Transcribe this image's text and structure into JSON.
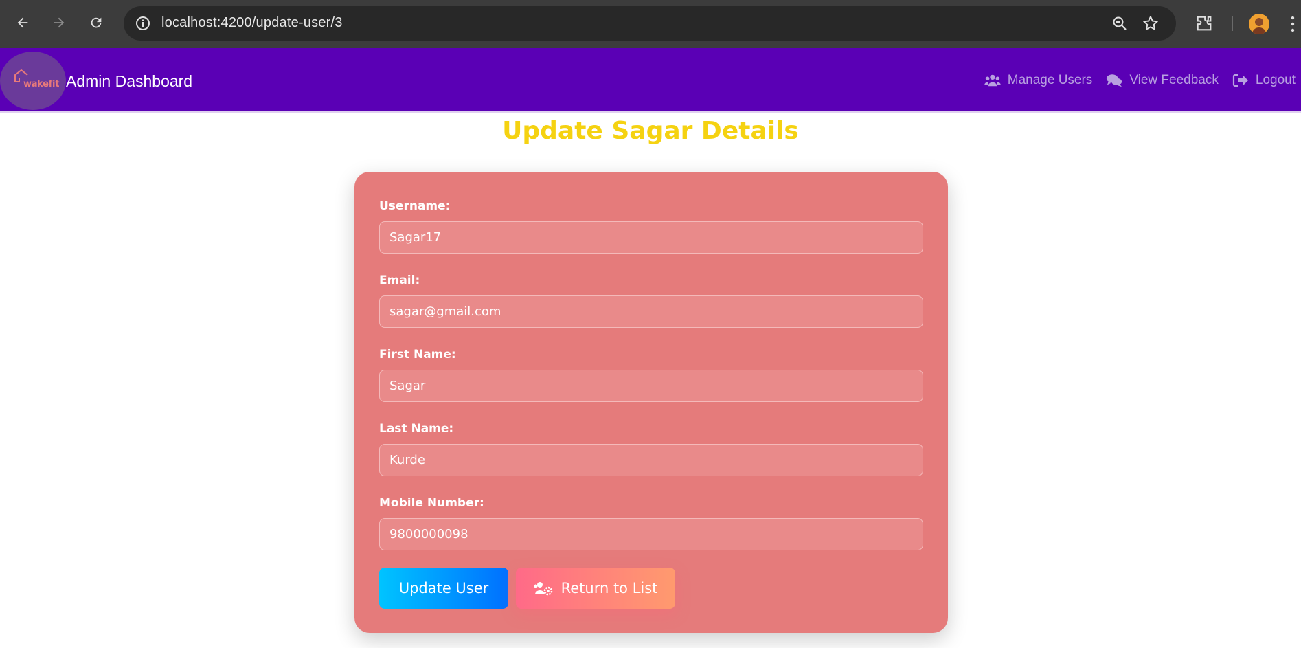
{
  "browser": {
    "url_host": "localhost",
    "url_path": ":4200/update-user/3",
    "icons": [
      "back-arrow-icon",
      "forward-arrow-icon",
      "reload-icon",
      "info-icon",
      "zoom-icon",
      "bookmark-star-icon",
      "extensions-icon",
      "profile-avatar",
      "menu-kebab-icon"
    ]
  },
  "navbar": {
    "logo_text": "wakefit",
    "title": "Admin Dashboard",
    "links": [
      {
        "label": "Manage Users",
        "icon": "users-icon"
      },
      {
        "label": "View Feedback",
        "icon": "comments-icon"
      },
      {
        "label": "Logout",
        "icon": "logout-icon"
      }
    ],
    "bg_color": "#5a00b5"
  },
  "page": {
    "title": "Update Sagar Details",
    "title_color": "#f5d211"
  },
  "form": {
    "fields": [
      {
        "label": "Username:",
        "value": "Sagar17"
      },
      {
        "label": "Email:",
        "value": "sagar@gmail.com"
      },
      {
        "label": "First Name:",
        "value": "Sagar"
      },
      {
        "label": "Last Name:",
        "value": "Kurde"
      },
      {
        "label": "Mobile Number:",
        "value": "9800000098"
      }
    ],
    "update_button": "Update User",
    "return_button": "Return to List",
    "card_color": "#e57b7b"
  }
}
